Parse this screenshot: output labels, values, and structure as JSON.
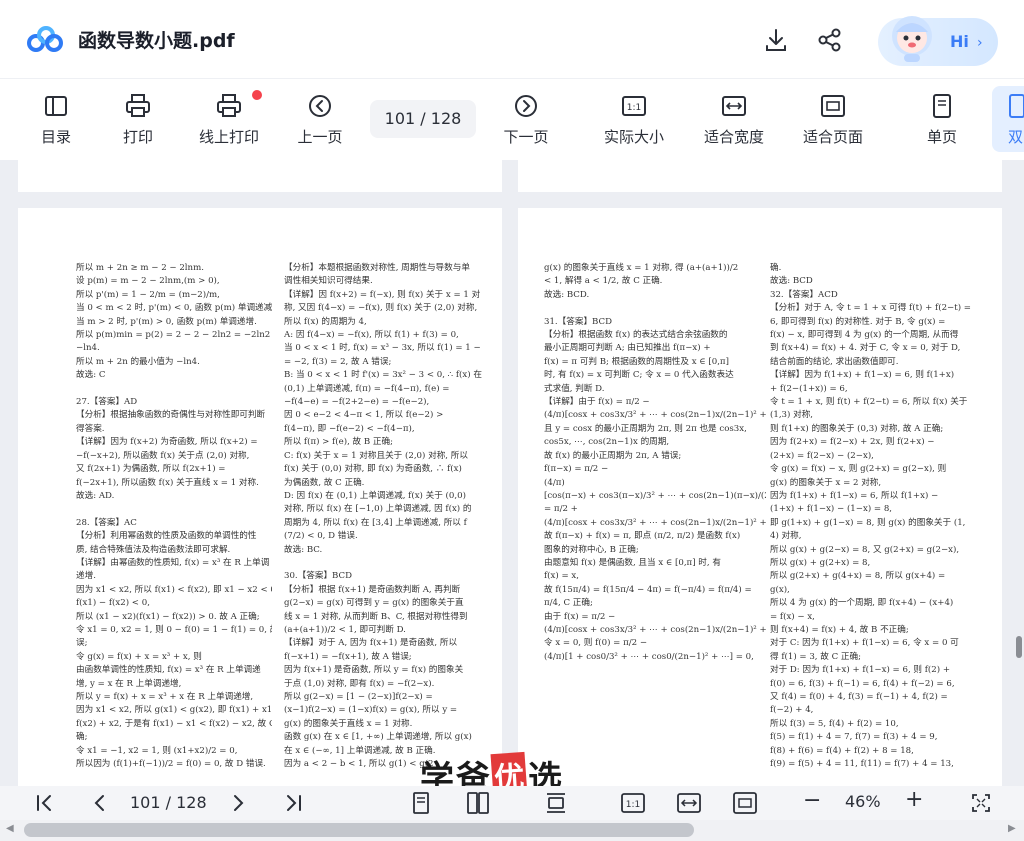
{
  "header": {
    "file_title": "函数导数小题.pdf",
    "download_icon": "download-icon",
    "share_icon": "share-icon",
    "assistant_greeting": "Hi",
    "assistant_chevron": "›"
  },
  "toolbar": {
    "items": [
      {
        "label": "目录",
        "icon": "toc-icon"
      },
      {
        "label": "打印",
        "icon": "print-icon"
      },
      {
        "label": "线上打印",
        "icon": "online-print-icon"
      },
      {
        "label": "上一页",
        "icon": "prev-page-icon"
      },
      {
        "label": "下一页",
        "icon": "next-page-icon"
      },
      {
        "label": "实际大小",
        "icon": "actual-size-icon"
      },
      {
        "label": "适合宽度",
        "icon": "fit-width-icon"
      },
      {
        "label": "适合页面",
        "icon": "fit-page-icon"
      },
      {
        "label": "单页",
        "icon": "single-page-icon"
      },
      {
        "label": "双",
        "icon": "double-page-icon"
      }
    ],
    "page_indicator": "101 / 128"
  },
  "document": {
    "left_col1": "所以 m + 2n ≥ m − 2 − 2lnm.\n设 p(m) = m − 2 − 2lnm,(m > 0),\n所以 p'(m) = 1 − 2/m = (m−2)/m,\n当 0 < m < 2 时, p'(m) < 0, 函数 p(m) 单调递减.\n当 m > 2 时, p'(m) > 0, 函数 p(m) 单调递增.\n所以 p(m)min = p(2) = 2 − 2 − 2ln2 = −2ln2 =\n−ln4.\n所以 m + 2n 的最小值为 −ln4.\n故选: C\n\n27.【答案】AD\n【分析】根据抽象函数的奇偶性与对称性即可判断\n得答案.\n【详解】因为 f(x+2) 为奇函数, 所以 f(x+2) =\n−f(−x+2), 所以函数 f(x) 关于点 (2,0) 对称,\n又 f(2x+1) 为偶函数, 所以 f(2x+1) =\nf(−2x+1), 所以函数 f(x) 关于直线 x = 1 对称.\n故选: AD.\n\n28.【答案】AC\n【分析】利用幂函数的性质及函数的单调性的性\n质, 结合特殊值法及构造函数法即可求解.\n【详解】由幂函数的性质知, f(x) = x³ 在 R 上单调\n递增.\n因为 x1 < x2, 所以 f(x1) < f(x2), 即 x1 − x2 < 0,\nf(x1) − f(x2) < 0,\n所以 (x1 − x2)(f(x1) − f(x2)) > 0. 故 A 正确;\n令 x1 = 0, x2 = 1, 则 0 − f(0) = 1 − f(1) = 0, 故 B 错\n误;\n令 g(x) = f(x) + x = x³ + x, 则\n由函数单调性的性质知, f(x) = x³ 在 R 上单调递\n增, y = x 在 R 上单调递增,\n所以 y = f(x) + x = x³ + x 在 R 上单调递增,\n因为 x1 < x2, 所以 g(x1) < g(x2), 即 f(x1) + x1 <\nf(x2) + x2, 于是有 f(x1) − x1 < f(x2) − x2, 故 C 正\n确;\n令 x1 = −1, x2 = 1, 则 (x1+x2)/2 = 0,\n所以因为 (f(1)+f(−1))/2 = f(0) = 0, 故 D 错误.",
    "left_col2": "【分析】本题根据函数对称性, 周期性与导数与单\n调性相关知识可得结果.\n【详解】因 f(x+2) = f(−x), 则 f(x) 关于 x = 1 对\n称, 又因 f(4−x) = −f(x), 则 f(x) 关于 (2,0) 对称,\n所以 f(x) 的周期为 4,\nA: 因 f(4−x) = −f(x), 所以 f(1) + f(3) = 0,\n当 0 < x < 1 时, f(x) = x³ − 3x, 所以 f(1) = 1 − 3\n= −2, f(3) = 2, 故 A 错误;\nB: 当 0 < x < 1 时 f'(x) = 3x² − 3 < 0, ∴ f(x) 在\n(0,1) 上单调递减, f(π) = −f(4−π), f(e) =\n−f(4−e) = −f(2+2−e) = −f(e−2),\n因 0 < e−2 < 4−π < 1, 所以 f(e−2) >\nf(4−π), 即 −f(e−2) < −f(4−π),\n所以 f(π) > f(e), 故 B 正确;\nC: f(x) 关于 x = 1 对称且关于 (2,0) 对称, 所以\nf(x) 关于 (0,0) 对称, 即 f(x) 为奇函数, ∴ f(x)\n为偶函数, 故 C 正确.\nD: 因 f(x) 在 (0,1) 上单调递减, f(x) 关于 (0,0)\n对称, 所以 f(x) 在 [−1,0) 上单调递减, 因 f(x) 的\n周期为 4, 所以 f(x) 在 [3,4] 上单调递减, 所以 f\n(7/2) < 0, D 错误.\n故选: BC.\n\n30.【答案】BCD\n【分析】根据 f(x+1) 是奇函数判断 A, 再判断\ng(2−x) = g(x) 可得到 y = g(x) 的图象关于直\n线 x = 1 对称, 从而判断 B、C, 根据对称性得到\n(a+(a+1))/2 < 1, 即可判断 D.\n【详解】对于 A, 因为 f(x+1) 是奇函数, 所以\nf(−x+1) = −f(x+1), 故 A 错误;\n因为 f(x+1) 是奇函数, 所以 y = f(x) 的图象关\n于点 (1,0) 对称, 即有 f(x) = −f(2−x).\n所以 g(2−x) = [1 − (2−x)]f(2−x) =\n(x−1)f(2−x) = (1−x)f(x) = g(x), 所以 y =\ng(x) 的图象关于直线 x = 1 对称.\n函数 g(x) 在 x ∈ [1, +∞) 上单调递增, 所以 g(x)\n在 x ∈ (−∞, 1] 上单调递减, 故 B 正确.\n因为 a < 2 − b < 1, 所以 g(1) < g(2",
    "right_col1": "g(x) 的图象关于直线 x = 1 对称, 得 (a+(a+1))/2\n< 1, 解得 a < 1/2, 故 C 正确.\n故选: BCD.\n\n31.【答案】BCD\n【分析】根据函数 f(x) 的表达式结合余弦函数的\n最小正周期可判断 A; 由已知推出 f(π−x) +\nf(x) = π 可判 B; 根据函数的周期性及 x ∈ [0,π]\n时, 有 f(x) = x 可判断 C; 令 x = 0 代入函数表达\n式求值, 判断 D.\n【详解】由于 f(x) = π/2 −\n(4/π)[cosx + cos3x/3² + ⋯ + cos(2n−1)x/(2n−1)² + ⋯],\n且 y = cosx 的最小正周期为 2π, 则 2π 也是 cos3x,\ncos5x, ⋯, cos(2n−1)x 的周期,\n故 f(x) 的最小正周期为 2π, A 错误;\nf(π−x) = π/2 −\n(4/π)\n[cos(π−x) + cos3(π−x)/3² + ⋯ + cos(2n−1)(π−x)/(2n−1)² + ⋯]\n= π/2 +\n(4/π)[cosx + cos3x/3² + ⋯ + cos(2n−1)x/(2n−1)² + ⋯],\n故 f(π−x) + f(x) = π, 即点 (π/2, π/2) 是函数 f(x)\n图象的对称中心, B 正确;\n由题意知 f(x) 是偶函数, 且当 x ∈ [0,π] 时, 有\nf(x) = x,\n故 f(15π/4) = f(15π/4 − 4π) = f(−π/4) = f(π/4) =\nπ/4, C 正确;\n由于 f(x) = π/2 −\n(4/π)[cosx + cos3x/3² + ⋯ + cos(2n−1)x/(2n−1)² + ⋯],\n令 x = 0, 则 f(0) = π/2 −\n(4/π)[1 + cos0/3² + ⋯ + cos0/(2n−1)² + ⋯] = 0,",
    "right_col2": "确.\n故选: BCD\n32.【答案】ACD\n【分析】对于 A, 令 t = 1 + x 可得 f(t) + f(2−t) =\n6, 即可得到 f(x) 的对称性. 对于 B, 令 g(x) =\nf(x) − x, 即可得到 4 为 g(x) 的一个周期, 从而得\n到 f(x+4) = f(x) + 4. 对于 C, 令 x = 0, 对于 D,\n结合前面的结论, 求出函数值即可.\n【详解】因为 f(1+x) + f(1−x) = 6, 则 f(1+x)\n+ f(2−(1+x)) = 6,\n令 t = 1 + x, 则 f(t) + f(2−t) = 6, 所以 f(x) 关于\n(1,3) 对称,\n则 f(1+x) 的图象关于 (0,3) 对称, 故 A 正确;\n因为 f(2+x) = f(2−x) + 2x, 则 f(2+x) −\n(2+x) = f(2−x) − (2−x),\n令 g(x) = f(x) − x, 则 g(2+x) = g(2−x), 则\ng(x) 的图象关于 x = 2 对称,\n因为 f(1+x) + f(1−x) = 6, 所以 f(1+x) −\n(1+x) + f(1−x) − (1−x) = 8,\n即 g(1+x) + g(1−x) = 8, 则 g(x) 的图象关于 (1,\n4) 对称,\n所以 g(x) + g(2−x) = 8, 又 g(2+x) = g(2−x),\n所以 g(x) + g(2+x) = 8,\n所以 g(2+x) + g(4+x) = 8, 所以 g(x+4) =\ng(x),\n所以 4 为 g(x) 的一个周期, 即 f(x+4) − (x+4)\n= f(x) − x,\n则 f(x+4) = f(x) + 4, 故 B 不正确;\n对于 C: 因为 f(1+x) + f(1−x) = 6, 令 x = 0 可\n得 f(1) = 3, 故 C 正确;\n对于 D: 因为 f(1+x) + f(1−x) = 6, 则 f(2) +\nf(0) = 6, f(3) + f(−1) = 6, f(4) + f(−2) = 6,\n又 f(4) = f(0) + 4, f(3) = f(−1) + 4, f(2) =\nf(−2) + 4,\n所以 f(3) = 5, f(4) + f(2) = 10,\nf(5) = f(1) + 4 = 7, f(7) = f(3) + 4 = 9,\nf(8) + f(6) = f(4) + f(2) + 8 = 18,\nf(9) = f(5) + 4 = 11, f(11) = f(7) + 4 = 13,",
    "watermark_chars": [
      "学",
      "爸",
      "优",
      "选"
    ]
  },
  "bottom_bar": {
    "first_page_icon": "first-page-icon",
    "prev_icon": "prev-icon",
    "page_indicator": "101 / 128",
    "next_icon": "next-icon",
    "last_page_icon": "last-page-icon",
    "zoom_level": "46%",
    "zoom_out": "−",
    "zoom_in": "+"
  },
  "colors": {
    "accent": "#3b7cf6",
    "notification": "#f5424c",
    "watermark_red": "#e23a3a"
  }
}
